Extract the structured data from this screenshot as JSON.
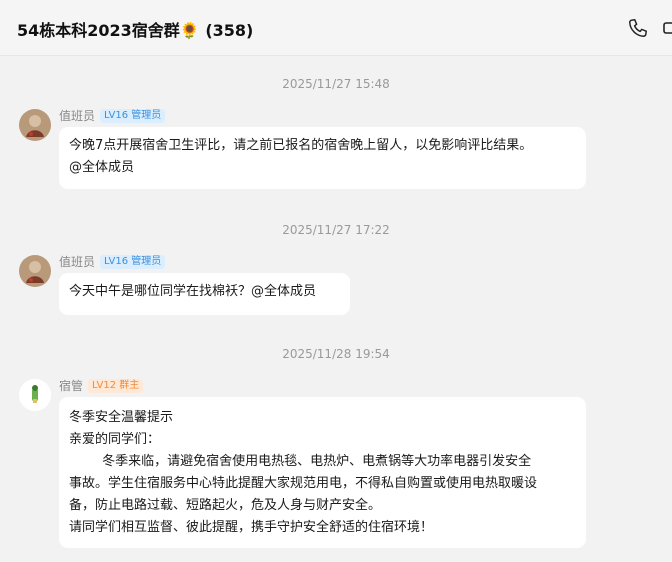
{
  "header": {
    "group_name": "54栋本科2023宿舍群",
    "sunflower": "🌻",
    "member_count": "(358)",
    "icons": [
      "phone-icon",
      "video-call-icon"
    ]
  },
  "messages": [
    {
      "timestamp": "2025/11/27 15:48",
      "sender": "值班员",
      "badge": "LV16 管理员",
      "lines": [
        "今晚7点开展宿舍卫生评比，请之前已报名的宿舍晚上留人，以免影响评比结果。",
        "@全体成员"
      ]
    },
    {
      "timestamp": "2025/11/27 17:22",
      "sender": "值班员",
      "badge": "LV16 管理员",
      "lines": [
        "今天中午是哪位同学在找棉袄？@全体成员"
      ]
    },
    {
      "timestamp": "2025/11/28 19:54",
      "sender": "宿管",
      "badge": "LV12 群主",
      "lines": [
        "冬季安全温馨提示",
        "亲爱的同学们：",
        "        冬季来临，请避免宿舍使用电热毯、电热炉、电煮锅等大功率电器引发安全",
        "事故。学生住宿服务中心特此提醒大家规范用电，不得私自购置或使用电热取暖设",
        "备，防止电路过载、短路起火，危及人身与财产安全。",
        "请同学们相互监督、彼此提醒，携手守护安全舒适的住宿环境！"
      ]
    }
  ],
  "colors": {
    "background": "#f2f2f2",
    "bubble": "#ffffff",
    "admin_badge": "#3b8fd9",
    "owner_badge": "#f08a3a"
  }
}
